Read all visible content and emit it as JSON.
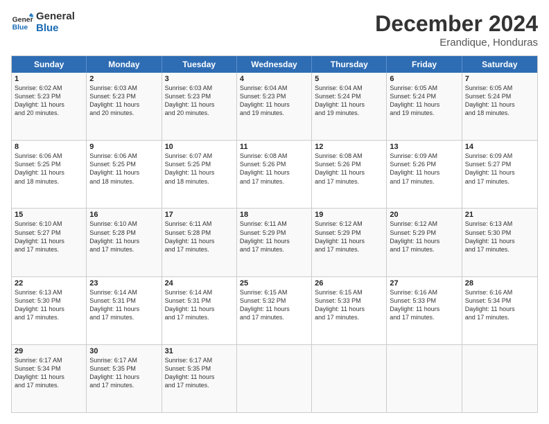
{
  "header": {
    "logo_line1": "General",
    "logo_line2": "Blue",
    "month": "December 2024",
    "location": "Erandique, Honduras"
  },
  "days_of_week": [
    "Sunday",
    "Monday",
    "Tuesday",
    "Wednesday",
    "Thursday",
    "Friday",
    "Saturday"
  ],
  "rows": [
    [
      {
        "day": "1",
        "lines": [
          "Sunrise: 6:02 AM",
          "Sunset: 5:23 PM",
          "Daylight: 11 hours",
          "and 20 minutes."
        ]
      },
      {
        "day": "2",
        "lines": [
          "Sunrise: 6:03 AM",
          "Sunset: 5:23 PM",
          "Daylight: 11 hours",
          "and 20 minutes."
        ]
      },
      {
        "day": "3",
        "lines": [
          "Sunrise: 6:03 AM",
          "Sunset: 5:23 PM",
          "Daylight: 11 hours",
          "and 20 minutes."
        ]
      },
      {
        "day": "4",
        "lines": [
          "Sunrise: 6:04 AM",
          "Sunset: 5:23 PM",
          "Daylight: 11 hours",
          "and 19 minutes."
        ]
      },
      {
        "day": "5",
        "lines": [
          "Sunrise: 6:04 AM",
          "Sunset: 5:24 PM",
          "Daylight: 11 hours",
          "and 19 minutes."
        ]
      },
      {
        "day": "6",
        "lines": [
          "Sunrise: 6:05 AM",
          "Sunset: 5:24 PM",
          "Daylight: 11 hours",
          "and 19 minutes."
        ]
      },
      {
        "day": "7",
        "lines": [
          "Sunrise: 6:05 AM",
          "Sunset: 5:24 PM",
          "Daylight: 11 hours",
          "and 18 minutes."
        ]
      }
    ],
    [
      {
        "day": "8",
        "lines": [
          "Sunrise: 6:06 AM",
          "Sunset: 5:25 PM",
          "Daylight: 11 hours",
          "and 18 minutes."
        ]
      },
      {
        "day": "9",
        "lines": [
          "Sunrise: 6:06 AM",
          "Sunset: 5:25 PM",
          "Daylight: 11 hours",
          "and 18 minutes."
        ]
      },
      {
        "day": "10",
        "lines": [
          "Sunrise: 6:07 AM",
          "Sunset: 5:25 PM",
          "Daylight: 11 hours",
          "and 18 minutes."
        ]
      },
      {
        "day": "11",
        "lines": [
          "Sunrise: 6:08 AM",
          "Sunset: 5:26 PM",
          "Daylight: 11 hours",
          "and 17 minutes."
        ]
      },
      {
        "day": "12",
        "lines": [
          "Sunrise: 6:08 AM",
          "Sunset: 5:26 PM",
          "Daylight: 11 hours",
          "and 17 minutes."
        ]
      },
      {
        "day": "13",
        "lines": [
          "Sunrise: 6:09 AM",
          "Sunset: 5:26 PM",
          "Daylight: 11 hours",
          "and 17 minutes."
        ]
      },
      {
        "day": "14",
        "lines": [
          "Sunrise: 6:09 AM",
          "Sunset: 5:27 PM",
          "Daylight: 11 hours",
          "and 17 minutes."
        ]
      }
    ],
    [
      {
        "day": "15",
        "lines": [
          "Sunrise: 6:10 AM",
          "Sunset: 5:27 PM",
          "Daylight: 11 hours",
          "and 17 minutes."
        ]
      },
      {
        "day": "16",
        "lines": [
          "Sunrise: 6:10 AM",
          "Sunset: 5:28 PM",
          "Daylight: 11 hours",
          "and 17 minutes."
        ]
      },
      {
        "day": "17",
        "lines": [
          "Sunrise: 6:11 AM",
          "Sunset: 5:28 PM",
          "Daylight: 11 hours",
          "and 17 minutes."
        ]
      },
      {
        "day": "18",
        "lines": [
          "Sunrise: 6:11 AM",
          "Sunset: 5:29 PM",
          "Daylight: 11 hours",
          "and 17 minutes."
        ]
      },
      {
        "day": "19",
        "lines": [
          "Sunrise: 6:12 AM",
          "Sunset: 5:29 PM",
          "Daylight: 11 hours",
          "and 17 minutes."
        ]
      },
      {
        "day": "20",
        "lines": [
          "Sunrise: 6:12 AM",
          "Sunset: 5:29 PM",
          "Daylight: 11 hours",
          "and 17 minutes."
        ]
      },
      {
        "day": "21",
        "lines": [
          "Sunrise: 6:13 AM",
          "Sunset: 5:30 PM",
          "Daylight: 11 hours",
          "and 17 minutes."
        ]
      }
    ],
    [
      {
        "day": "22",
        "lines": [
          "Sunrise: 6:13 AM",
          "Sunset: 5:30 PM",
          "Daylight: 11 hours",
          "and 17 minutes."
        ]
      },
      {
        "day": "23",
        "lines": [
          "Sunrise: 6:14 AM",
          "Sunset: 5:31 PM",
          "Daylight: 11 hours",
          "and 17 minutes."
        ]
      },
      {
        "day": "24",
        "lines": [
          "Sunrise: 6:14 AM",
          "Sunset: 5:31 PM",
          "Daylight: 11 hours",
          "and 17 minutes."
        ]
      },
      {
        "day": "25",
        "lines": [
          "Sunrise: 6:15 AM",
          "Sunset: 5:32 PM",
          "Daylight: 11 hours",
          "and 17 minutes."
        ]
      },
      {
        "day": "26",
        "lines": [
          "Sunrise: 6:15 AM",
          "Sunset: 5:33 PM",
          "Daylight: 11 hours",
          "and 17 minutes."
        ]
      },
      {
        "day": "27",
        "lines": [
          "Sunrise: 6:16 AM",
          "Sunset: 5:33 PM",
          "Daylight: 11 hours",
          "and 17 minutes."
        ]
      },
      {
        "day": "28",
        "lines": [
          "Sunrise: 6:16 AM",
          "Sunset: 5:34 PM",
          "Daylight: 11 hours",
          "and 17 minutes."
        ]
      }
    ],
    [
      {
        "day": "29",
        "lines": [
          "Sunrise: 6:17 AM",
          "Sunset: 5:34 PM",
          "Daylight: 11 hours",
          "and 17 minutes."
        ]
      },
      {
        "day": "30",
        "lines": [
          "Sunrise: 6:17 AM",
          "Sunset: 5:35 PM",
          "Daylight: 11 hours",
          "and 17 minutes."
        ]
      },
      {
        "day": "31",
        "lines": [
          "Sunrise: 6:17 AM",
          "Sunset: 5:35 PM",
          "Daylight: 11 hours",
          "and 17 minutes."
        ]
      },
      {
        "day": "",
        "lines": []
      },
      {
        "day": "",
        "lines": []
      },
      {
        "day": "",
        "lines": []
      },
      {
        "day": "",
        "lines": []
      }
    ]
  ]
}
